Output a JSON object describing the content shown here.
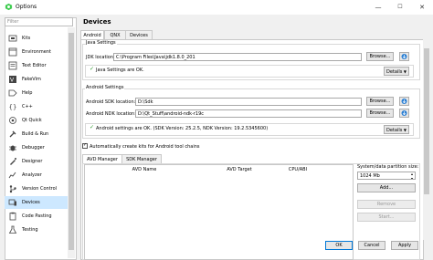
{
  "window": {
    "title": "Options",
    "minimize_label": "—",
    "maximize_label": "☐",
    "close_label": "✕"
  },
  "sidebar": {
    "filter_placeholder": "Filter",
    "items": [
      {
        "label": "Kits",
        "icon": "kits-icon"
      },
      {
        "label": "Environment",
        "icon": "environment-icon"
      },
      {
        "label": "Text Editor",
        "icon": "text-editor-icon"
      },
      {
        "label": "FakeVim",
        "icon": "fakevim-icon"
      },
      {
        "label": "Help",
        "icon": "help-icon"
      },
      {
        "label": "C++",
        "icon": "cpp-icon"
      },
      {
        "label": "Qt Quick",
        "icon": "qt-quick-icon"
      },
      {
        "label": "Build & Run",
        "icon": "build-run-icon"
      },
      {
        "label": "Debugger",
        "icon": "debugger-icon"
      },
      {
        "label": "Designer",
        "icon": "designer-icon"
      },
      {
        "label": "Analyzer",
        "icon": "analyzer-icon"
      },
      {
        "label": "Version Control",
        "icon": "version-control-icon"
      },
      {
        "label": "Devices",
        "icon": "devices-icon",
        "selected": true
      },
      {
        "label": "Code Pasting",
        "icon": "code-pasting-icon"
      },
      {
        "label": "Testing",
        "icon": "testing-icon"
      }
    ]
  },
  "main": {
    "heading": "Devices",
    "tabs": [
      {
        "label": "Android",
        "active": true
      },
      {
        "label": "QNX"
      },
      {
        "label": "Devices"
      }
    ],
    "java": {
      "group_title": "Java Settings",
      "jdk_label": "JDK location:",
      "jdk_value": "C:\\Program Files\\Java\\jdk1.8.0_201",
      "browse_label": "Browse...",
      "status_text": "Java Settings are OK.",
      "details_label": "Details"
    },
    "android": {
      "group_title": "Android Settings",
      "sdk_label": "Android SDK location:",
      "sdk_value": "D:\\Sdk",
      "ndk_label": "Android NDK location:",
      "ndk_value": "D:\\Qt_Stuff\\android-ndk-r19c",
      "browse_label": "Browse...",
      "status_text": "Android settings are OK. (SDK Version: 25.2.5, NDK Version: 19.2.5345600)",
      "details_label": "Details"
    },
    "auto_create_label": "Automatically create kits for Android tool chains",
    "subtabs": [
      {
        "label": "AVD Manager",
        "active": true
      },
      {
        "label": "SDK Manager"
      }
    ],
    "avd_table": {
      "columns": [
        "AVD Name",
        "AVD Target",
        "CPU/ABI"
      ]
    },
    "partition": {
      "label": "System/data partition size:",
      "value": "1024 Mb",
      "add_label": "Add...",
      "remove_label": "Remove",
      "start_label": "Start..."
    }
  },
  "footer": {
    "ok_label": "OK",
    "cancel_label": "Cancel",
    "apply_label": "Apply"
  },
  "colors": {
    "selection": "#cde8ff",
    "ok_check": "#2e9b2e",
    "primary_border": "#0078d7"
  }
}
